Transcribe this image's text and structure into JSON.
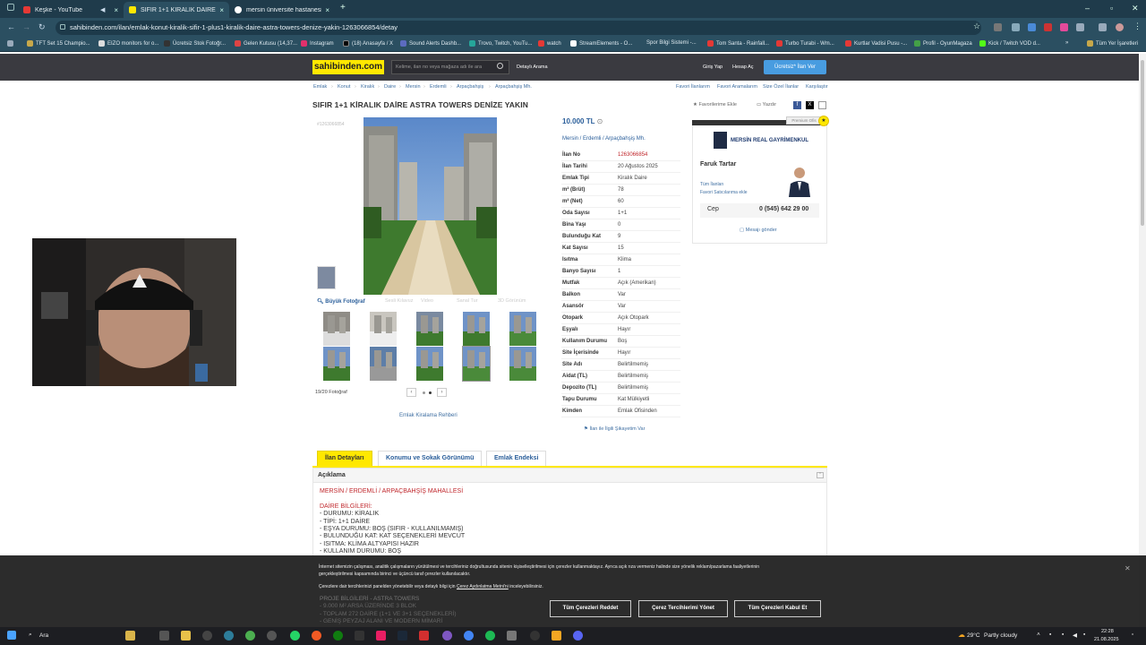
{
  "browser": {
    "tabs": [
      {
        "title": "Keşke - YouTube",
        "active": false
      },
      {
        "title": "SIFIR 1+1 KİRALIK DAİRE ASTRA",
        "active": true
      },
      {
        "title": "mersin üniversite hastanesi - G",
        "active": false
      }
    ],
    "url": "sahibinden.com/ilan/emlak-konut-kiralik-sifir-1-plus1-kiralik-daire-astra-towers-denize-yakin-1263066854/detay",
    "bookmarks": [
      "TFT Set 15 Champio...",
      "EIZO monitors for o...",
      "Ücretsiz Stok Fotoğr...",
      "Gelen Kutusu (14,37...",
      "Instagram",
      "(18) Anasayfa / X",
      "Sound Alerts Dashb...",
      "Trovo, Twitch, YouTu...",
      "watch",
      "StreamElements - O...",
      "Spor Bilgi Sistemi -...",
      "Tom Santa - Rainfall...",
      "Turbo Turabi - Wm...",
      "Kurtlar Vadisi Pusu -...",
      "Profil - OyunMagaza",
      "Kick / Twitch VOD d..."
    ],
    "bookmarks_more": "Tüm Yer İşaretleri"
  },
  "site": {
    "logo": "sahibinden.com",
    "search_placeholder": "Kelime, ilan no veya mağaza adı ile ara",
    "detailed_search": "Detaylı Arama",
    "login": "Giriş Yap",
    "register": "Hesap Aç",
    "post_ad": "Ücretsiz* İlan Ver"
  },
  "breadcrumb": [
    "Emlak",
    "Konut",
    "Kiralık",
    "Daire",
    "Mersin",
    "Erdemli",
    "Arpaçbahşiş",
    "Arpaçbahşiş Mh."
  ],
  "top_links": [
    "Favori İlanlarım",
    "Favori Aramalarım",
    "Size Özel İlanlar",
    "Karşılaştır"
  ],
  "listing": {
    "title": "SIFIR 1+1 KİRALIK DAİRE ASTRA TOWERS DENİZE YAKIN",
    "add_favorites": "Favorilerime Ekle",
    "print": "Yazdır",
    "id_small": "#1263066854",
    "big_photo": "Büyük Fotoğraf",
    "photo_tools": [
      "Sesli Kılavuz",
      "Video",
      "Sanal Tur",
      "3D Görünüm"
    ],
    "photo_count": "19/20 Fotoğraf",
    "rental_guide": "Emlak Kiralama Rehberi",
    "price": "10.000 TL",
    "location": [
      "Mersin",
      "Erdemli",
      "Arpaçbahşiş Mh."
    ],
    "details": [
      {
        "k": "İlan No",
        "v": "1263066854"
      },
      {
        "k": "İlan Tarihi",
        "v": "20 Ağustos 2025"
      },
      {
        "k": "Emlak Tipi",
        "v": "Kiralık Daire"
      },
      {
        "k": "m² (Brüt)",
        "v": "78"
      },
      {
        "k": "m² (Net)",
        "v": "60"
      },
      {
        "k": "Oda Sayısı",
        "v": "1+1"
      },
      {
        "k": "Bina Yaşı",
        "v": "0"
      },
      {
        "k": "Bulunduğu Kat",
        "v": "9"
      },
      {
        "k": "Kat Sayısı",
        "v": "15"
      },
      {
        "k": "Isıtma",
        "v": "Klima"
      },
      {
        "k": "Banyo Sayısı",
        "v": "1"
      },
      {
        "k": "Mutfak",
        "v": "Açık (Amerikan)"
      },
      {
        "k": "Balkon",
        "v": "Var"
      },
      {
        "k": "Asansör",
        "v": "Var"
      },
      {
        "k": "Otopark",
        "v": "Açık Otopark"
      },
      {
        "k": "Eşyalı",
        "v": "Hayır"
      },
      {
        "k": "Kullanım Durumu",
        "v": "Boş"
      },
      {
        "k": "Site İçerisinde",
        "v": "Hayır"
      },
      {
        "k": "Site Adı",
        "v": "Belirtilmemiş"
      },
      {
        "k": "Aidat (TL)",
        "v": "Belirtilmemiş"
      },
      {
        "k": "Depozito (TL)",
        "v": "Belirtilmemiş"
      },
      {
        "k": "Tapu Durumu",
        "v": "Kat Mülkiyetli"
      },
      {
        "k": "Kimden",
        "v": "Emlak Ofisinden"
      }
    ],
    "report": "İlan ile İlgili Şikayetim Var"
  },
  "seller": {
    "premium": "Premium Ofis",
    "store": "MERSİN REAL GAYRİMENKUL",
    "agent": "Faruk Tartar",
    "all_ads": "Tüm İlanları",
    "favorite_seller": "Favori Satıcılarıma ekle",
    "phone_label": "Cep",
    "phone": "0 (545) 642 29 00",
    "message": "Mesajı gönder"
  },
  "detail_tabs": [
    "İlan Detayları",
    "Konumu ve Sokak Görünümü",
    "Emlak Endeksi"
  ],
  "description": {
    "header": "Açıklama",
    "lines": [
      {
        "t": "MERSİN / ERDEMLİ / ARPAÇBAHŞİŞ MAHALLESİ",
        "red": true
      },
      {
        "t": "",
        "red": false
      },
      {
        "t": "DAİRE BİLGİLERİ:",
        "red": true
      },
      {
        "t": "- DURUMU: KİRALIK",
        "red": false
      },
      {
        "t": "- TİPİ: 1+1 DAİRE",
        "red": false
      },
      {
        "t": "- EŞYA DURUMU: BOŞ (SIFIR - KULLANILMAMIŞ)",
        "red": false
      },
      {
        "t": "- BULUNDUĞU KAT: KAT SEÇENEKLERİ MEVCUT",
        "red": false
      },
      {
        "t": "- ISITMA: KLİMA ALTYAPISI HAZIR",
        "red": false
      },
      {
        "t": "- KULLANIM DURUMU: BOŞ",
        "red": false
      }
    ]
  },
  "cookie": {
    "text1": "İnternet sitemizin çalışması, analitik çalışmaların yürütülmesi ve tercihleriniz doğrultusunda sitenin kişiselleştirilmesi için çerezler kullanmaktayız. Ayrıca açık rıza vermeniz halinde size yönelik reklam/pazarlama faaliyetlerinin",
    "text2": "gerçekleştirilmesi kapsamında birinci ve üçüncü taraf çerezler kullanılacaktır.",
    "text3": "Çerezlere dair tercihlerinizi panelden yönetebilir veya detaylı bilgi için",
    "policy_link": "Çerez Aydınlatma Metni'ni",
    "text4": "inceleyebilirsiniz.",
    "behind1": "PROJE BİLGİLERİ - ASTRA TOWERS",
    "behind2": "- 9.000 M² ARSA ÜZERİNDE 3 BLOK",
    "behind3": "- TOPLAM 272 DAİRE (1+1 VE 3+1 SEÇENEKLERİ)",
    "behind4": "- GENİŞ PEYZAJ ALANI VE MODERN MİMARİ",
    "reject": "Tüm Çerezleri Reddet",
    "manage": "Çerez Tercihlerimi Yönet",
    "accept": "Tüm Çerezleri Kabul Et"
  },
  "taskbar": {
    "search": "Ara",
    "weather": "29°C",
    "weather_desc": "Partly cloudy",
    "time": "22:28",
    "date": "21.08.2025"
  }
}
